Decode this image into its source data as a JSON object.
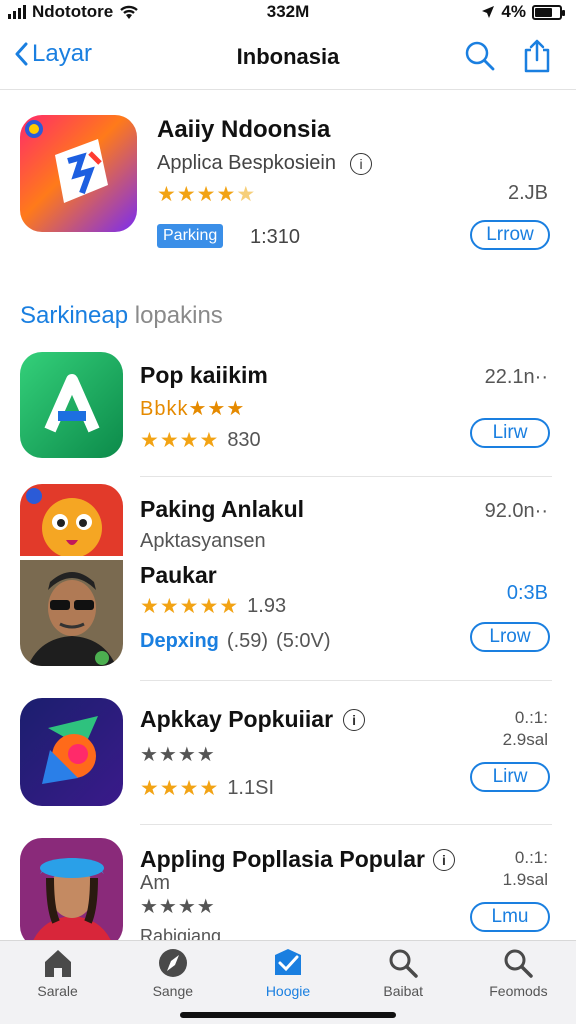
{
  "status": {
    "carrier": "Ndototore",
    "time": "332M",
    "battery": "4%"
  },
  "nav": {
    "back_label": "Layar",
    "title": "Inbonasia"
  },
  "featured": {
    "title": "Aaiiy Ndoonsia",
    "subtitle": "Applica Bespkosiein",
    "rating_text": "★★★★",
    "badge": "Parking",
    "count": "1:310",
    "size": "2.JB",
    "button": "Lrrow"
  },
  "section": {
    "title_highlight": "Sarkineap",
    "title_rest": " lopakins"
  },
  "apps": [
    {
      "title": "Pop kaiikim",
      "line1": "Bbkk★★★",
      "stars": "★★★★",
      "count": "830",
      "size": "22.1n··",
      "button": "Lirw"
    },
    {
      "title": "Paking Anlakul",
      "line1": "Apktasyansen",
      "size": "92.0n··"
    },
    {
      "title": "Paukar",
      "stars": "★★★★★",
      "count": "1.93",
      "line2a": "Depxing",
      "line2b": "(.59)",
      "line2c": "(5:0V)",
      "size": "0:3B",
      "button": "Lrow"
    },
    {
      "title": "Apkkay Popkuiiar",
      "stars": "★★★★",
      "stars2": "★★★★",
      "count": "1.1SI",
      "size": "0.:1:",
      "size2": "2.9sal",
      "button": "Lirw"
    },
    {
      "title": "Appling Popllasia Popular",
      "line1": "Am",
      "stars": "★★★★",
      "line3": "Rabiqiang",
      "size": "0.:1:",
      "size2": "1.9sal",
      "button": "Lmu"
    }
  ],
  "tabs": [
    "Sarale",
    "Sange",
    "Hoogie",
    "Baibat",
    "Feomods"
  ],
  "colors": {
    "accent": "#1a7fe0",
    "star": "#f2a314"
  }
}
